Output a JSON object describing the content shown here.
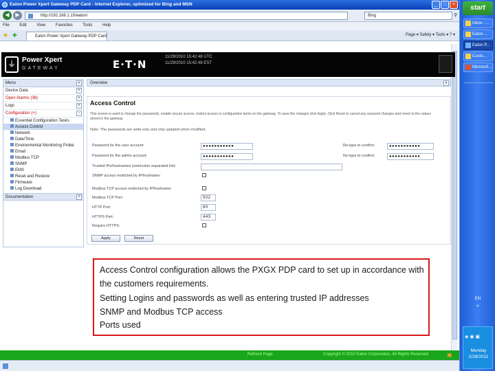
{
  "window": {
    "title": "Eaton Power Xpert Gateway PDP Card - Internet Explorer, optimized for Bing and MSN",
    "url": "http://192.168.1.10/eaton/",
    "search_placeholder": "Bing"
  },
  "menu": [
    "File",
    "Edit",
    "View",
    "Favorites",
    "Tools",
    "Help"
  ],
  "tab": {
    "label": "Eaton Power Xpert Gateway PDP Card"
  },
  "browser_tools": "Page ▾  Safety ▾  Tools ▾  ? ▾",
  "banner": {
    "product_line1": "Power Xpert",
    "product_line2": "GATEWAY",
    "brand": "E·T·N",
    "datetime_1": "11/29/2010 15:42:48 UTC",
    "datetime_2": "11/29/2010 15:42:48 EST"
  },
  "nav": {
    "menu": "Menu",
    "device_data": "Device Data",
    "open_alarms": "Open Alarms (36)",
    "logs": "Logs",
    "configuration": "Configuration (+)",
    "sub_items": [
      "Essential Configuration Tasks",
      "Access Control",
      "Network",
      "Date/Time",
      "Environmental Monitoring Probe",
      "Email",
      "Modbus TCP",
      "SNMP",
      "EMS",
      "Reset and Restore",
      "Firmware",
      "Log Download"
    ],
    "documentation": "Documentation"
  },
  "overview": {
    "label": "Overview"
  },
  "access": {
    "title": "Access Control",
    "description": "This screen is used to change the passwords, enable secure access, restrict access to configuration items on the gateway. To save the changes click Apply. Click Reset to cancel any unsaved changes and revert to the values stored in the gateway.",
    "note": "Note: The passwords are write-only and only updated when modified.",
    "user_pw_label": "Password for the user account:",
    "user_pw_value": "●●●●●●●●●●●",
    "user_confirm_label": "Re-type to confirm:",
    "user_confirm_value": "●●●●●●●●●●●",
    "admin_pw_label": "Password for the admin account:",
    "admin_pw_value": "●●●●●●●●●●●",
    "admin_confirm_label": "Re-type to confirm:",
    "admin_confirm_value": "●●●●●●●●●●●",
    "trusted_label": "Trusted IPs/hostnames (semicolon separated list):",
    "trusted_value": "",
    "snmp_label": "SNMP access restricted by IP/hostname:",
    "modbus_label": "Modbus TCP access restricted by IP/hostname:",
    "modbus_port_label": "Modbus TCP Port:",
    "modbus_port_value": "502",
    "http_port_label": "HTTP Port:",
    "http_port_value": "80",
    "https_port_label": "HTTPS Port:",
    "https_port_value": "443",
    "require_https_label": "Require HTTPS:",
    "apply": "Apply",
    "reset": "Reset"
  },
  "status": {
    "left": "Refresh Page",
    "right": "Copyright © 2010 Eaton Corporation, All Rights Reserved"
  },
  "callout": {
    "line1": "Access Control configuration allows the PXGX PDP card to set up in accordance with the customers requirements.",
    "line2": "Setting Logins and passwords as well as entering trusted IP addresses",
    "line3": "SNMP and Modbus TCP access",
    "line4": "Ports used"
  },
  "taskbar": {
    "start": "start",
    "tasks": [
      "Inbox - ...",
      "Eaton ...",
      "Eaton P...",
      "Custo...",
      "Microsof..."
    ],
    "lang": "EN",
    "clock": "Monday\n2/28/2011"
  },
  "colors": {
    "callout_border": "#d81818",
    "status_green": "#1aa61a",
    "taskbar_blue": "#2160d8"
  }
}
